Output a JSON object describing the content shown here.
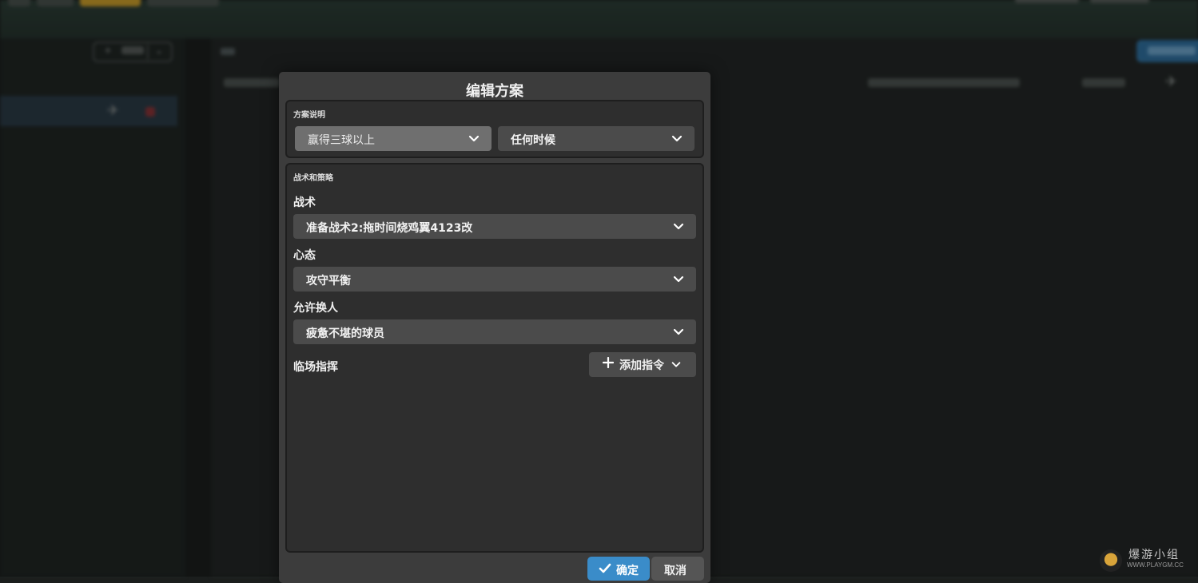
{
  "dialog": {
    "title": "编辑方案",
    "scheme_section": {
      "caption": "方案说明",
      "condition_value": "赢得三球以上",
      "timing_value": "任何时候"
    },
    "tactics_section": {
      "caption": "战术和策略",
      "tactic": {
        "label": "战术",
        "value": "准备战术2:拖时间烧鸡翼4123改"
      },
      "mentality": {
        "label": "心态",
        "value": "攻守平衡"
      },
      "substitution": {
        "label": "允许换人",
        "value": "疲惫不堪的球员"
      },
      "touchline": {
        "label": "临场指挥",
        "add_button": "添加指令"
      }
    },
    "ok_button": "确定",
    "cancel_button": "取消"
  },
  "watermark": {
    "name": "爆游小组",
    "url": "WWW.PLAYGM.CC"
  },
  "colors": {
    "accent": "#3a8cc9",
    "dialog_bg": "#3c3c3c",
    "section_bg": "#2e2e2e",
    "dropdown_bg": "#4b4b4b"
  }
}
